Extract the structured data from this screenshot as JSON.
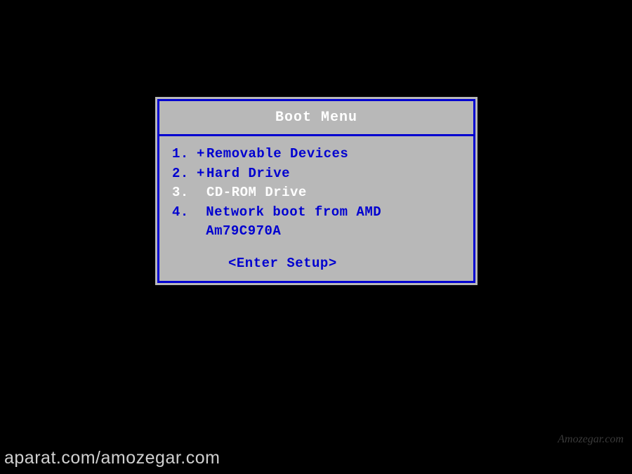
{
  "boot_menu": {
    "title": "Boot Menu",
    "items": [
      {
        "number": "1.",
        "prefix": "+",
        "label": "Removable Devices",
        "selected": false
      },
      {
        "number": "2.",
        "prefix": "+",
        "label": "Hard Drive",
        "selected": false
      },
      {
        "number": "3.",
        "prefix": " ",
        "label": "CD-ROM Drive",
        "selected": true
      },
      {
        "number": "4.",
        "prefix": " ",
        "label": "Network boot from AMD Am79C970A",
        "selected": false
      }
    ],
    "footer": "<Enter Setup>"
  },
  "watermarks": {
    "bottom_left": "aparat.com/amozegar.com",
    "bottom_right": "Amozegar.com"
  }
}
